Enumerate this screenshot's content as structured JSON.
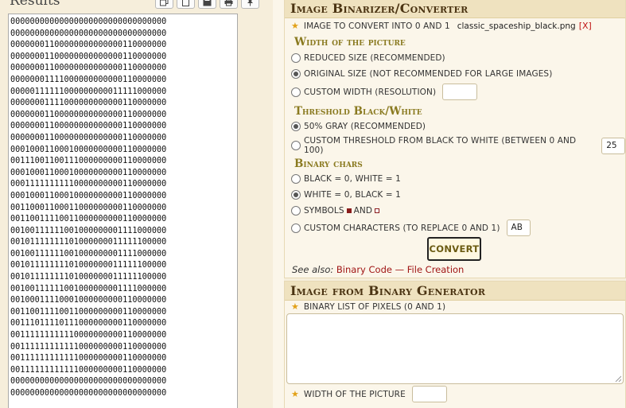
{
  "results": {
    "title": "Results",
    "text": "00000000000000000000000000000000\n00000000000000000000000000000000\n00000001100000000000000110000000\n00000001100000000000000110000000\n00000001100000000000000110000000\n00000001111000000000000110000000\n00000111111000000000011111000000\n00000001111000000000000110000000\n00000001100000000000000110000000\n00000001100000000000000110000000\n00000001100000000000000110000000\n00010001100010000000000110000000\n00111001100111000000000110000000\n00010001100010000000000110000000\n00011111111110000000000110000000\n00010001100010000000000110000000\n00110001100011000000000110000000\n00110011110011000000000110000000\n00100111111001000000001111000000\n00101111111101000000011111100000\n00100111111001000000001111000000\n00101111111101000000011111100000\n00101111111101000000011111100000\n00100111111001000000001111000000\n00100011110001000000000110000000\n00110011110011000000000110000000\n00111011110111000000000110000000\n00111111111110000000000110000000\n00111111111111000000000110000000\n00111111111111000000000110000000\n00111111111111000000000110000000\n00000000000000000000000000000000\n00000000000000000000000000000000",
    "toolbar_icons": [
      "copy-icon",
      "clipboard-icon",
      "save-icon",
      "print-icon",
      "pin-icon"
    ]
  },
  "binarizer": {
    "title": "Image Binarizer/Converter",
    "image_label": "Image to convert into 0 and 1",
    "filename": "classic_spaceship_black.png",
    "remove": "[X]",
    "width_heading": "Width of the picture",
    "width_options": [
      {
        "label": "Reduced size (recommended)",
        "checked": false
      },
      {
        "label": "Original size (not recommended for large images)",
        "checked": true
      },
      {
        "label": "Custom width (resolution)",
        "checked": false
      }
    ],
    "custom_width_value": "",
    "threshold_heading": "Threshold Black/White",
    "threshold_options": [
      {
        "label": "50% gray (recommended)",
        "checked": true
      },
      {
        "label": "Custom threshold from black to white (between 0 and 100)",
        "checked": false
      }
    ],
    "threshold_value": "25",
    "chars_heading": "Binary chars",
    "chars_options": [
      {
        "label": "Black = 0, White = 1",
        "checked": false
      },
      {
        "label": "White = 0, Black = 1",
        "checked": true
      },
      {
        "label_before": "Symbols",
        "label_after": "and",
        "checked": false
      },
      {
        "label": "Custom characters (to replace 0 and 1)",
        "checked": false
      }
    ],
    "custom_chars_value": "AB",
    "convert_label": "CONVERT",
    "see_also_label": "See also:",
    "see_also_links": [
      "Binary Code",
      "File Creation"
    ],
    "see_also_sep": "—"
  },
  "generator": {
    "title": "Image from Binary Generator",
    "list_label": "Binary list of pixels (0 and 1)",
    "list_value": "",
    "width_label": "Width of the picture",
    "width_value": ""
  },
  "colors": {
    "accent": "#e2a118",
    "link": "#a01515",
    "heading": "#4b3413",
    "subheading": "#8a7a20"
  }
}
